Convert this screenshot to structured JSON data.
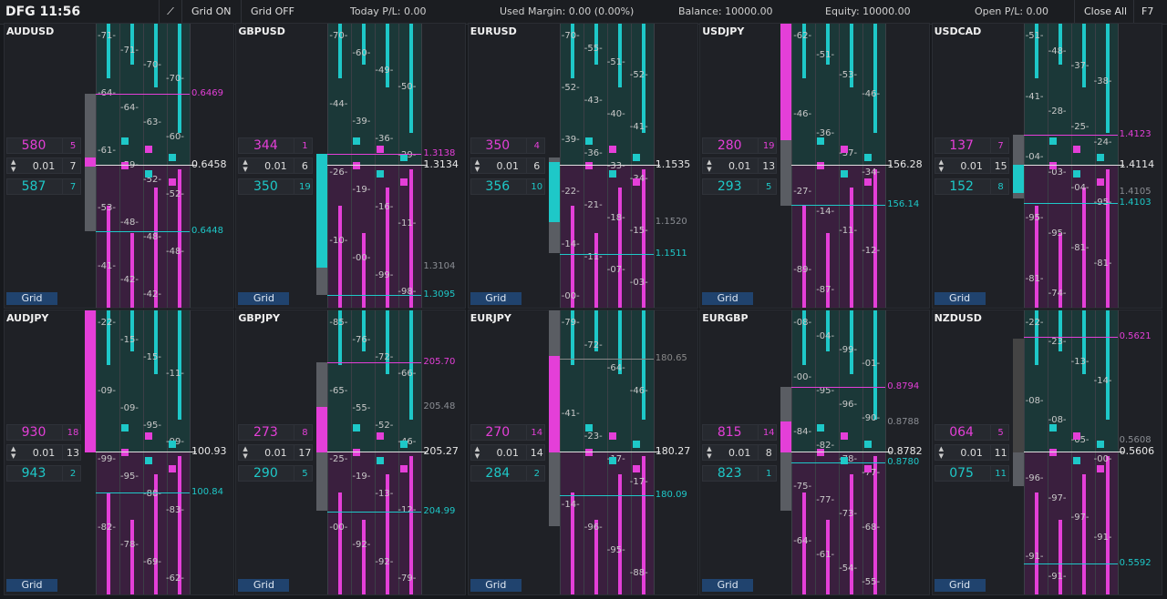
{
  "header": {
    "time": "DFG 11:56",
    "grid_on": "Grid ON",
    "grid_off": "Grid OFF",
    "today_pl": "Today P/L: 0.00",
    "used_margin": "Used Margin: 0.00 (0.00%)",
    "balance": "Balance: 10000.00",
    "equity": "Equity: 10000.00",
    "open_pl": "Open P/L: 0.00",
    "close_all": "Close All",
    "f7": "F7"
  },
  "colors": {
    "cyan": "#1ec8c8",
    "magenta": "#e43fd8",
    "grid_button": "#20436e"
  },
  "icons": {
    "pin": "pin-icon",
    "arrows": "up-down-arrows-icon"
  },
  "panels": [
    {
      "symbol": "AUDUSD",
      "bid": "580",
      "bid_n": "5",
      "lot": "0.01",
      "lot_n": "7",
      "ask": "587",
      "ask_n": "7",
      "grid": "Grid",
      "price_top": "0.6469",
      "price_mid": "0.6458",
      "price_bot": "0.6448",
      "ticks": [
        "-71-",
        "-71-",
        "-70-",
        "-70-",
        "-64-",
        "-64-",
        "-63-",
        "-60-",
        "-61-",
        "-59-",
        "-52-",
        "-52-",
        "-53-",
        "-48-",
        "-48-",
        "-48-",
        "-41-",
        "-42-",
        "-42-"
      ]
    },
    {
      "symbol": "GBPUSD",
      "bid": "344",
      "bid_n": "1",
      "lot": "0.01",
      "lot_n": "6",
      "ask": "350",
      "ask_n": "19",
      "grid": "Grid",
      "price_top": "1.3138",
      "price_mid": "1.3134",
      "price_bot": "1.3095",
      "price_extra": "1.3104",
      "ticks": [
        "-70-",
        "-60-",
        "-49-",
        "-50-",
        "-44-",
        "-39-",
        "-36-",
        "-29-",
        "-26-",
        "-19-",
        "-16-",
        "-11-",
        "-10-",
        "-00-",
        "-99-",
        "-98-"
      ]
    },
    {
      "symbol": "EURUSD",
      "bid": "350",
      "bid_n": "4",
      "lot": "0.01",
      "lot_n": "6",
      "ask": "356",
      "ask_n": "10",
      "grid": "Grid",
      "price_top": "",
      "price_mid": "1.1535",
      "price_bot": "1.1511",
      "price_extra": "1.1520",
      "ticks": [
        "-70-",
        "-55-",
        "-51-",
        "-52-",
        "-52-",
        "-43-",
        "-40-",
        "-41-",
        "-39-",
        "-36-",
        "-33-",
        "-34-",
        "-22-",
        "-21-",
        "-18-",
        "-15-",
        "-14-",
        "-11-",
        "-07-",
        "-03-",
        "-00-"
      ]
    },
    {
      "symbol": "USDJPY",
      "bid": "280",
      "bid_n": "19",
      "lot": "0.01",
      "lot_n": "13",
      "ask": "293",
      "ask_n": "5",
      "grid": "Grid",
      "price_top": "",
      "price_mid": "156.28",
      "price_bot": "156.14",
      "ticks": [
        "-62-",
        "-51-",
        "-53-",
        "-46-",
        "-46-",
        "-36-",
        "-37-",
        "-34-",
        "-27-",
        "-14-",
        "-11-",
        "-12-",
        "-89-",
        "-87-"
      ]
    },
    {
      "symbol": "USDCAD",
      "bid": "137",
      "bid_n": "7",
      "lot": "0.01",
      "lot_n": "15",
      "ask": "152",
      "ask_n": "8",
      "grid": "Grid",
      "price_top": "1.4123",
      "price_mid": "1.4114",
      "price_bot": "1.4103",
      "price_extra": "1.4105",
      "ticks": [
        "-51-",
        "-48-",
        "-37-",
        "-38-",
        "-41-",
        "-28-",
        "-25-",
        "-24-",
        "-04-",
        "-03-",
        "-04-",
        "-95-",
        "-95-",
        "-95-",
        "-81-",
        "-81-",
        "-81-",
        "-74-"
      ]
    },
    {
      "symbol": "AUDJPY",
      "bid": "930",
      "bid_n": "18",
      "lot": "0.01",
      "lot_n": "13",
      "ask": "943",
      "ask_n": "2",
      "grid": "Grid",
      "price_top": "",
      "price_mid": "100.93",
      "price_bot": "100.84",
      "ticks": [
        "-22-",
        "-15-",
        "-15-",
        "-11-",
        "-09-",
        "-09-",
        "-95-",
        "-99-",
        "-99-",
        "-95-",
        "-88-",
        "-83-",
        "-82-",
        "-78-",
        "-69-",
        "-62-"
      ]
    },
    {
      "symbol": "GBPJPY",
      "bid": "273",
      "bid_n": "8",
      "lot": "0.01",
      "lot_n": "17",
      "ask": "290",
      "ask_n": "5",
      "grid": "Grid",
      "price_top": "205.70",
      "price_mid": "205.27",
      "price_bot": "204.99",
      "price_extra": "205.48",
      "ticks": [
        "-85-",
        "-76-",
        "-72-",
        "-66-",
        "-65-",
        "-55-",
        "-52-",
        "-46-",
        "-25-",
        "-19-",
        "-13-",
        "-12-",
        "-00-",
        "-92-",
        "-92-",
        "-79-"
      ]
    },
    {
      "symbol": "EURJPY",
      "bid": "270",
      "bid_n": "14",
      "lot": "0.01",
      "lot_n": "14",
      "ask": "284",
      "ask_n": "2",
      "grid": "Grid",
      "price_top": "180.65",
      "price_mid": "180.27",
      "price_bot": "180.09",
      "ticks": [
        "-79-",
        "-72-",
        "-64-",
        "-46-",
        "-41-",
        "-23-",
        "-17-",
        "-17-",
        "-14-",
        "-96-",
        "-95-",
        "-88-"
      ]
    },
    {
      "symbol": "EURGBP",
      "bid": "815",
      "bid_n": "14",
      "lot": "0.01",
      "lot_n": "8",
      "ask": "823",
      "ask_n": "1",
      "grid": "Grid",
      "price_top": "0.8794",
      "price_mid": "0.8782",
      "price_bot": "0.8780",
      "price_extra": "0.8788",
      "ticks": [
        "-08-",
        "-04-",
        "-99-",
        "-01-",
        "-00-",
        "-95-",
        "-96-",
        "-90-",
        "-84-",
        "-82-",
        "-78-",
        "-77-",
        "-75-",
        "-77-",
        "-73-",
        "-68-",
        "-64-",
        "-61-",
        "-54-",
        "-55-"
      ]
    },
    {
      "symbol": "NZDUSD",
      "bid": "064",
      "bid_n": "5",
      "lot": "0.01",
      "lot_n": "11",
      "ask": "075",
      "ask_n": "11",
      "grid": "Grid",
      "price_top": "0.5621",
      "price_mid": "0.5606",
      "price_bot": "0.5592",
      "price_extra": "0.5608",
      "ticks": [
        "-22-",
        "-23-",
        "-13-",
        "-14-",
        "-08-",
        "-08-",
        "-05-",
        "-00-",
        "-96-",
        "-97-",
        "-97-",
        "-91-",
        "-91-",
        "-91-"
      ]
    }
  ]
}
